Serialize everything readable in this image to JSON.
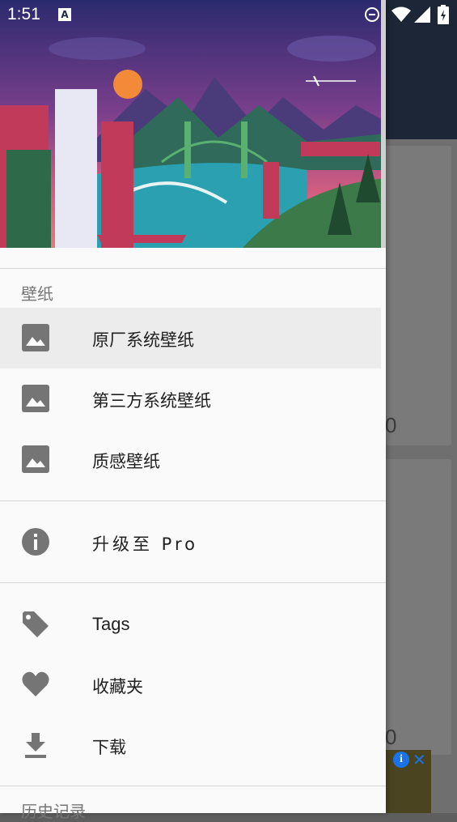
{
  "status_bar": {
    "time": "1:51",
    "icons": [
      "text-a-icon",
      "dnd-icon",
      "wifi-icon",
      "signal-icon",
      "battery-icon"
    ]
  },
  "background_app": {
    "card_values": [
      "0",
      "0"
    ],
    "ad_close": "✕",
    "ad_info": "i"
  },
  "drawer": {
    "header_image": "city-illustration",
    "sections": {
      "wallpapers": {
        "title": "壁纸",
        "items": [
          {
            "label": "原厂系统壁纸",
            "icon": "image-icon",
            "selected": true
          },
          {
            "label": "第三方系统壁纸",
            "icon": "image-icon"
          },
          {
            "label": "质感壁纸",
            "icon": "image-icon"
          }
        ]
      },
      "upgrade": {
        "label": "升级至 Pro",
        "icon": "info-icon"
      },
      "misc": {
        "items": [
          {
            "label": "Tags",
            "icon": "tag-icon"
          },
          {
            "label": "收藏夹",
            "icon": "heart-icon"
          },
          {
            "label": "下载",
            "icon": "download-icon"
          }
        ]
      },
      "history": {
        "title": "历史记录"
      }
    }
  },
  "colors": {
    "icon_gray": "#757575",
    "toolbar": "#1d2636",
    "selected_bg": "#ececec"
  }
}
